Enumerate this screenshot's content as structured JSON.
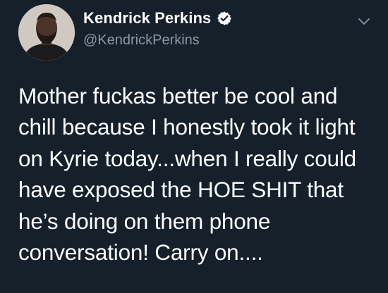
{
  "colors": {
    "background": "#15202b",
    "text": "#ffffff",
    "secondary_text": "#8899a6",
    "verified": "#ffffff"
  },
  "author": {
    "display_name": "Kendrick Perkins",
    "handle": "@KendrickPerkins",
    "verified": true,
    "avatar_icon": "profile-photo",
    "verified_icon": "verified-badge-icon"
  },
  "menu": {
    "icon": "chevron-down-icon"
  },
  "tweet": {
    "lines": [
      "Mother fuckas better be cool and",
      "chill because I honestly took it light",
      "on Kyrie today...when I really could",
      "have exposed the HOE SHIT that",
      "he’s doing on them phone",
      "conversation! Carry on...."
    ]
  }
}
